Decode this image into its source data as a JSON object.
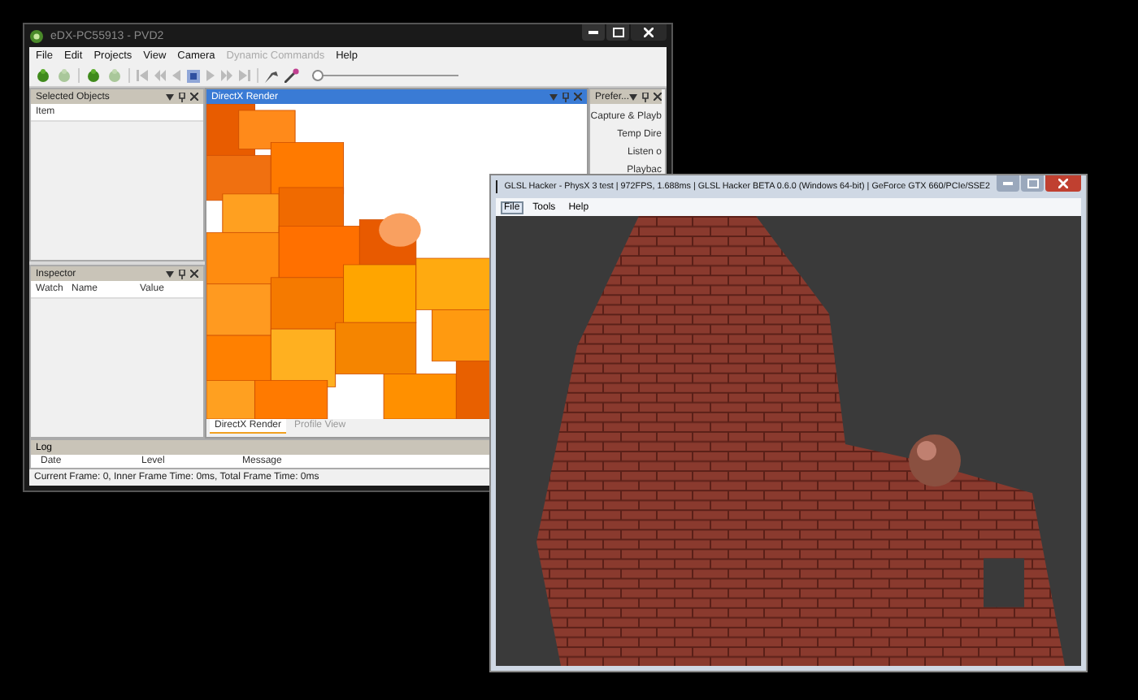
{
  "main_window": {
    "title": "eDX-PC55913 - PVD2",
    "menu": [
      {
        "label": "File",
        "disabled": false
      },
      {
        "label": "Edit",
        "disabled": false
      },
      {
        "label": "Projects",
        "disabled": false
      },
      {
        "label": "View",
        "disabled": false
      },
      {
        "label": "Camera",
        "disabled": false
      },
      {
        "label": "Dynamic Commands",
        "disabled": true
      },
      {
        "label": "Help",
        "disabled": false
      }
    ],
    "timeline": {
      "level": 0
    },
    "selected_objects": {
      "title": "Selected Objects",
      "columns": [
        "Item"
      ]
    },
    "inspector": {
      "title": "Inspector",
      "columns": [
        "Watch",
        "Name",
        "Value"
      ]
    },
    "render_panel": {
      "title": "DirectX Render",
      "tabs": [
        {
          "label": "DirectX Render",
          "selected": true
        },
        {
          "label": "Profile View",
          "selected": false
        }
      ]
    },
    "preferences": {
      "title": "Prefer...",
      "items": [
        "Capture & Playb",
        "Temp Dire",
        "Listen o",
        "Playbac"
      ]
    },
    "log": {
      "title": "Log",
      "columns": [
        "Date",
        "Level",
        "Message"
      ]
    },
    "status_bar": "Current Frame: 0, Inner Frame Time: 0ms, Total Frame Time: 0ms"
  },
  "glsl_window": {
    "title": "GLSL Hacker - PhysX 3 test | 972FPS, 1.688ms | GLSL Hacker BETA 0.6.0 (Windows 64-bit) | GeForce GTX 660/PCIe/SSE2",
    "menu": [
      {
        "label": "File",
        "selected": true
      },
      {
        "label": "Tools",
        "selected": false
      },
      {
        "label": "Help",
        "selected": false
      }
    ]
  }
}
